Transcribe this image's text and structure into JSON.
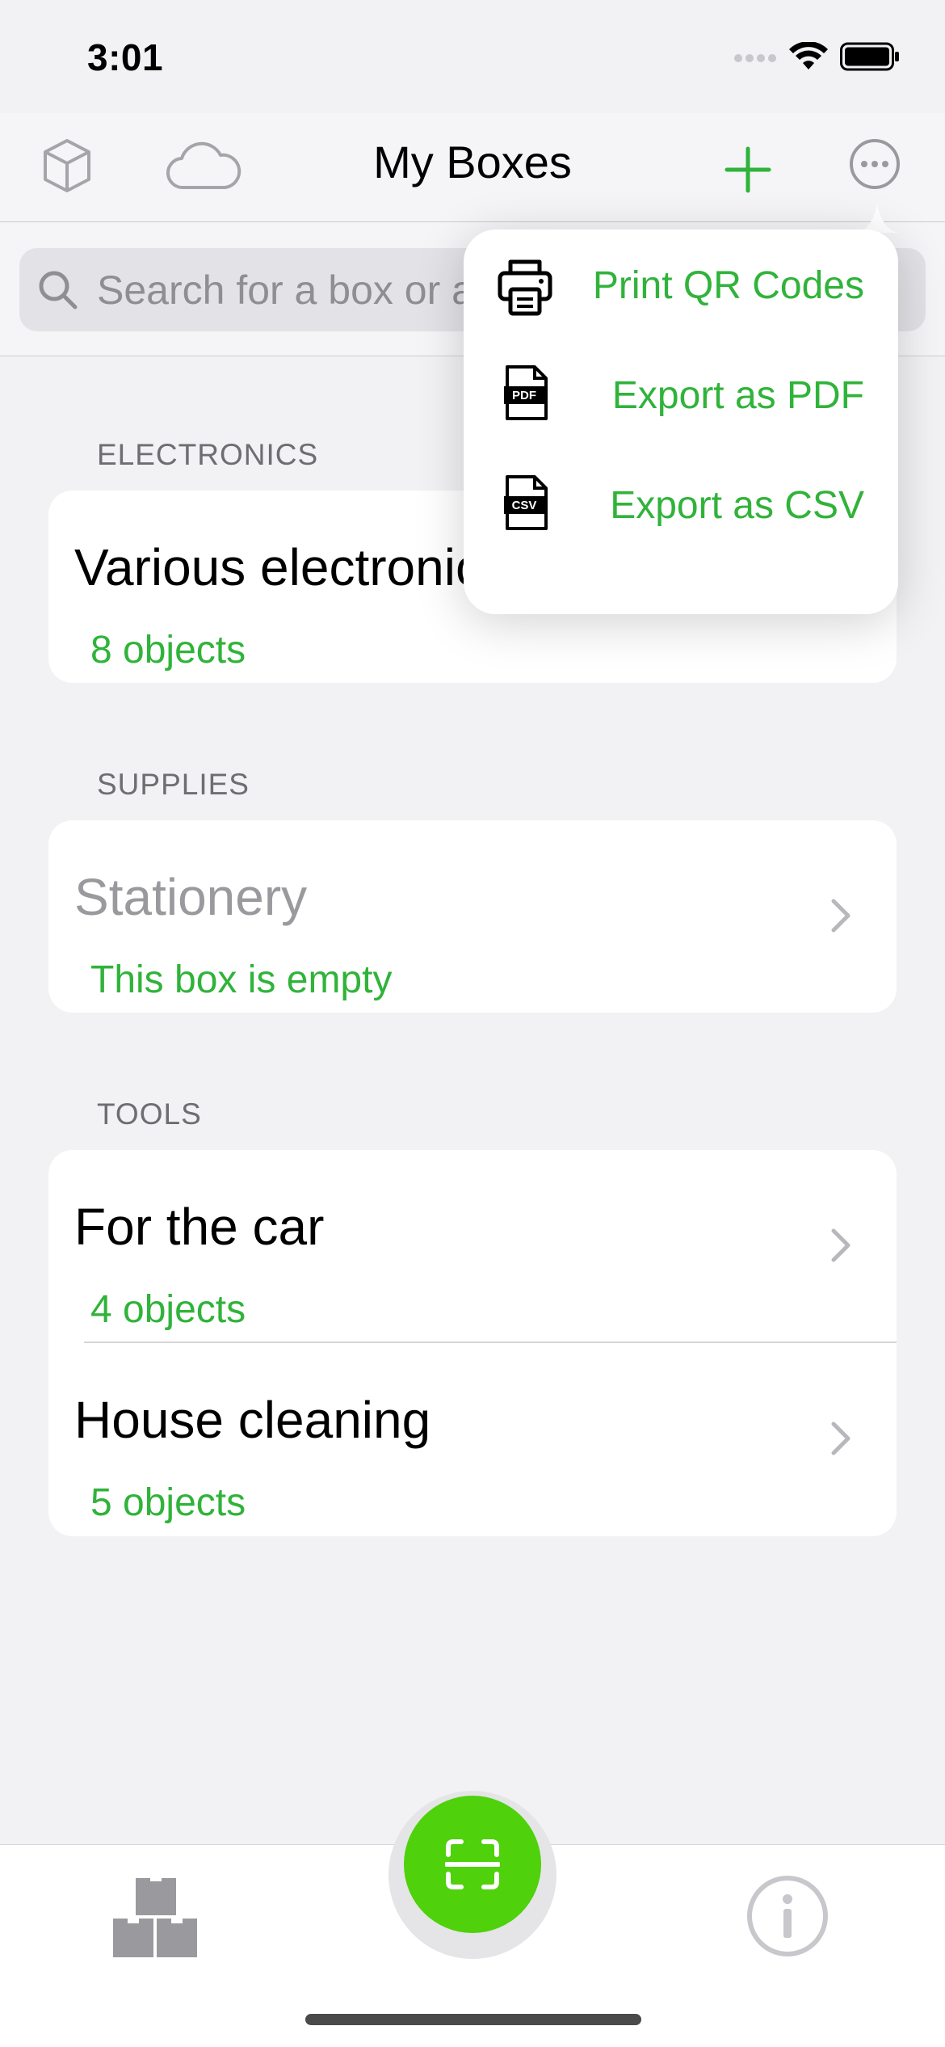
{
  "status_bar": {
    "time": "3:01"
  },
  "nav": {
    "title": "My Boxes",
    "icons": [
      "box-icon",
      "cloud-icon",
      "plus-icon",
      "more-icon"
    ]
  },
  "search": {
    "placeholder": "Search for a box or an object"
  },
  "sections": [
    {
      "header": "ELECTRONICS",
      "rows": [
        {
          "title": "Various electronics",
          "subtitle": "8 objects"
        }
      ]
    },
    {
      "header": "SUPPLIES",
      "rows": [
        {
          "title": "Stationery",
          "subtitle": "This box is empty"
        }
      ]
    },
    {
      "header": "TOOLS",
      "rows": [
        {
          "title": "For the car",
          "subtitle": "4 objects"
        },
        {
          "title": "House cleaning",
          "subtitle": "5 objects"
        }
      ]
    }
  ],
  "popover": {
    "items": [
      {
        "label": "Print QR Codes",
        "icon": "printer-icon"
      },
      {
        "label": "Export as PDF",
        "icon": "pdf-file-icon",
        "badge": "PDF"
      },
      {
        "label": "Export as CSV",
        "icon": "csv-file-icon",
        "badge": "CSV"
      }
    ]
  },
  "tabbar": {
    "icons": [
      "boxes-tab-icon",
      "scan-icon",
      "info-icon"
    ]
  },
  "colors": {
    "accent_green": "#30b33a",
    "scan_green": "#4fd10b",
    "gray_icon": "#9a9a9e"
  }
}
